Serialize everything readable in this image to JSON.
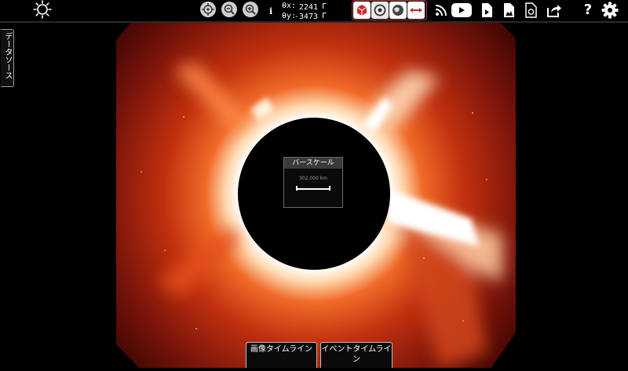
{
  "toolbar": {
    "coords": {
      "x_label": "θx:",
      "x_value": "2241",
      "x_unit": "Γ",
      "y_label": "θy:",
      "y_value": "-3473",
      "y_unit": "Γ"
    },
    "icons": {
      "logo": "helioviewer-sun-logo-icon",
      "center": "crosshair-center-icon",
      "zoom_out": "zoom-out-icon",
      "zoom_in": "zoom-in-icon",
      "info": "info-icon",
      "mode_3d": "cube-3d-icon",
      "mode_disk": "disk-view-icon",
      "mode_sphere": "sphere-view-icon",
      "mode_distance": "distance-measure-icon",
      "rss": "rss-icon",
      "youtube": "youtube-icon",
      "movie": "movie-file-icon",
      "image": "image-file-icon",
      "jhelioviewer": "jhelioviewer-icon",
      "share": "share-icon",
      "help": "help-icon",
      "settings": "settings-gear-icon"
    },
    "help_glyph": "?"
  },
  "side_tab": {
    "label": "データソース"
  },
  "barscale": {
    "title": "バースケール",
    "distance": "302,000 km"
  },
  "timeline": {
    "image_label": "画像タイムライン",
    "event_label": "イベントタイムライン"
  },
  "colors": {
    "accent_red": "#c92b2b",
    "corona_core": "#ffffff",
    "corona_mid": "#e0461a",
    "corona_outer": "#5a0a04"
  }
}
